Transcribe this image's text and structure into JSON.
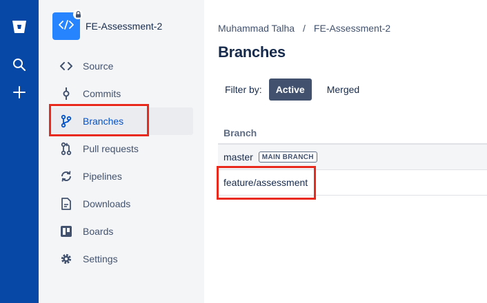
{
  "global_nav": {
    "logo_icon": "bitbucket-logo-icon",
    "search_icon": "search-icon",
    "create_icon": "plus-icon"
  },
  "repo": {
    "name": "FE-Assessment-2",
    "avatar_icon": "code-icon",
    "private_icon": "lock-icon"
  },
  "sidebar": {
    "items": [
      {
        "label": "Source",
        "icon": "source-code-icon",
        "active": false
      },
      {
        "label": "Commits",
        "icon": "commit-icon",
        "active": false
      },
      {
        "label": "Branches",
        "icon": "branch-icon",
        "active": true
      },
      {
        "label": "Pull requests",
        "icon": "pull-request-icon",
        "active": false
      },
      {
        "label": "Pipelines",
        "icon": "pipelines-icon",
        "active": false
      },
      {
        "label": "Downloads",
        "icon": "document-icon",
        "active": false
      },
      {
        "label": "Boards",
        "icon": "board-icon",
        "active": false
      },
      {
        "label": "Settings",
        "icon": "gear-icon",
        "active": false
      }
    ]
  },
  "breadcrumb": {
    "owner": "Muhammad Talha",
    "separator": "/",
    "repo": "FE-Assessment-2"
  },
  "page": {
    "title": "Branches"
  },
  "filter": {
    "label": "Filter by:",
    "options": [
      "Active",
      "Merged"
    ],
    "selected": "Active"
  },
  "table": {
    "column_header": "Branch",
    "rows": [
      {
        "name": "master",
        "badge": "MAIN BRANCH"
      },
      {
        "name": "feature/assessment",
        "badge": ""
      }
    ]
  },
  "colors": {
    "global_nav": "#0747a6",
    "sidebar_bg": "#f4f5f7",
    "accent": "#0052cc",
    "highlight_box": "#e8291b"
  }
}
